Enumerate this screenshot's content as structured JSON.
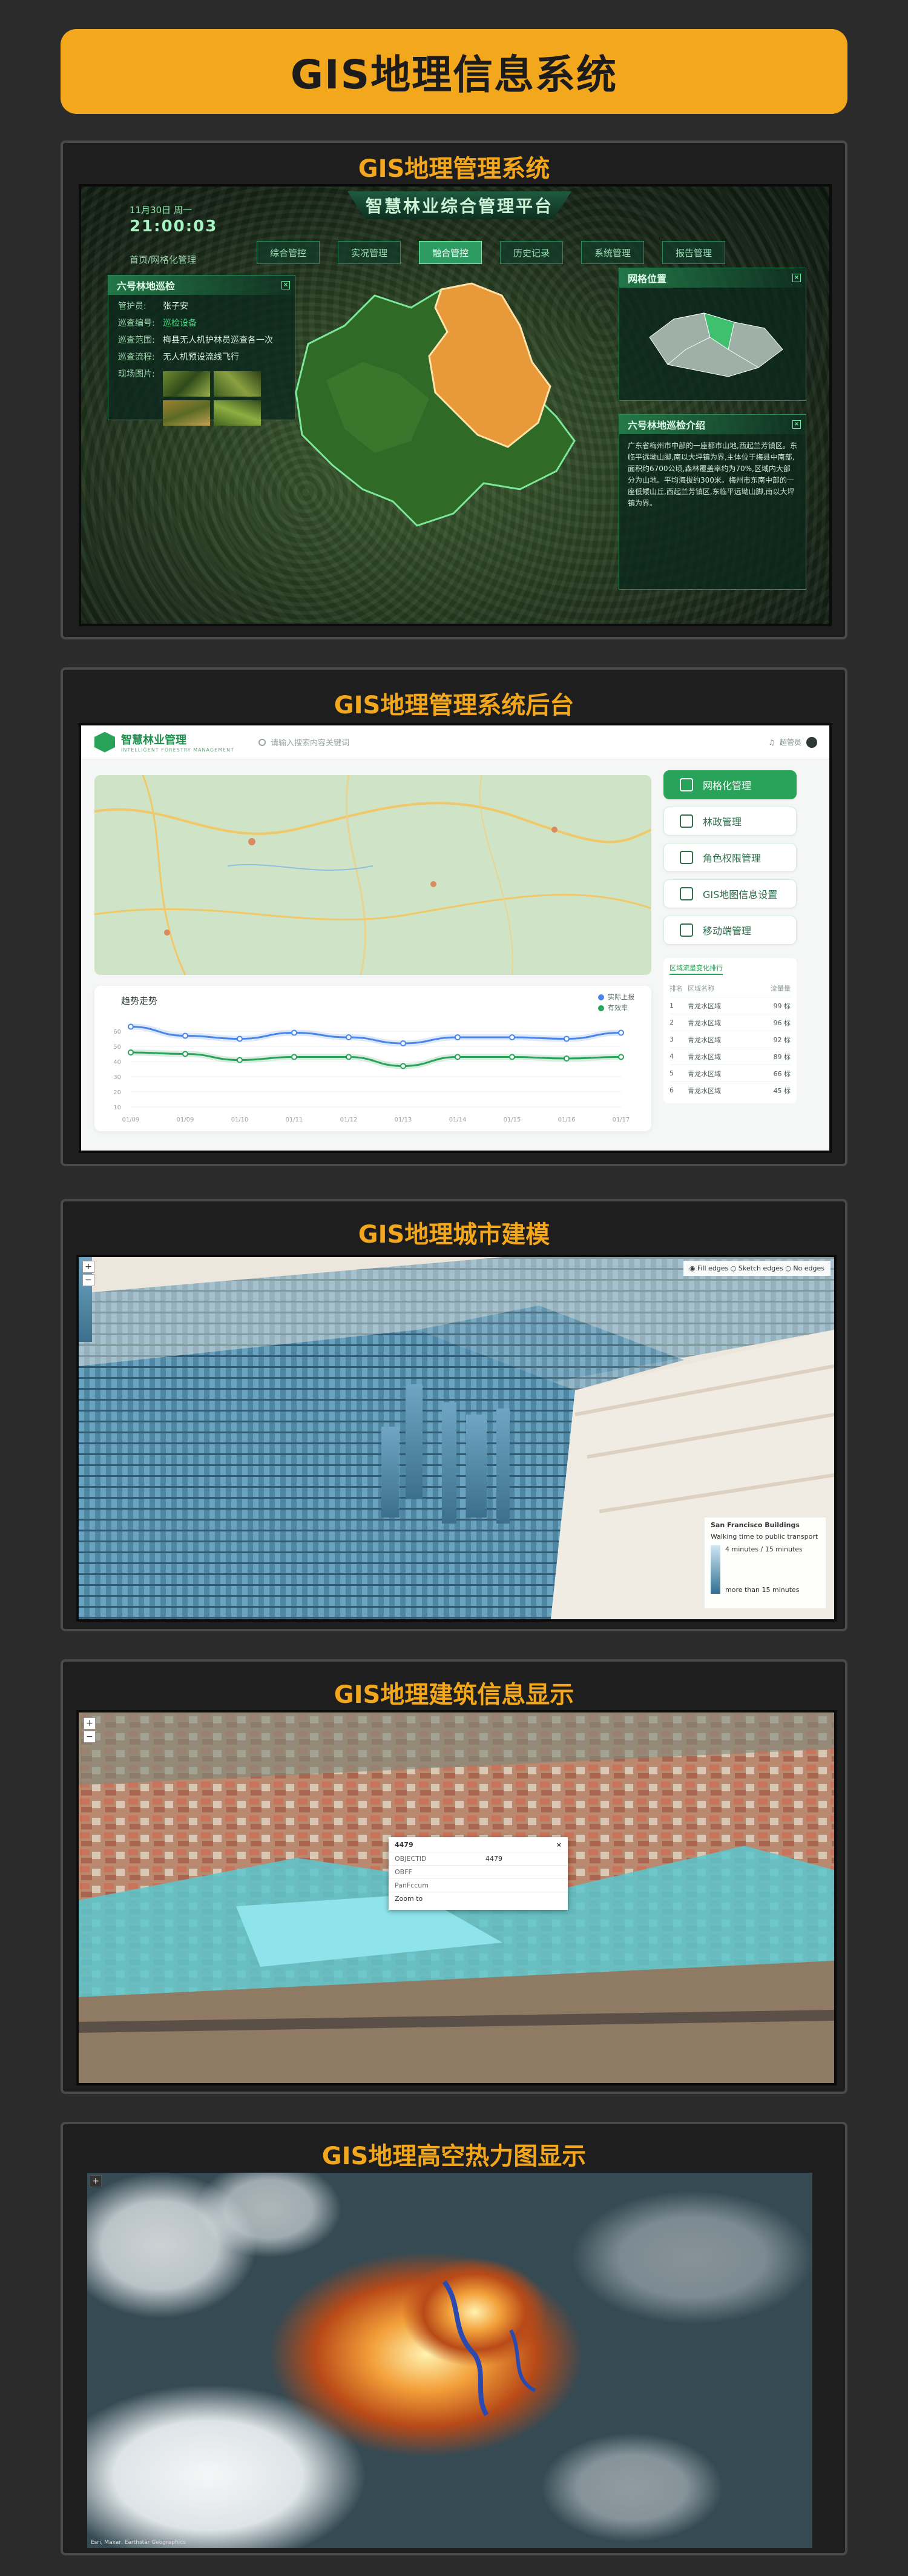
{
  "header": {
    "title": "GIS地理信息系统"
  },
  "colors": {
    "accent": "#f3a71c",
    "background": "#2b2b2b",
    "green": "#2aa35a"
  },
  "sections": [
    {
      "title": "GIS地理管理系统"
    },
    {
      "title": "GIS地理管理系统后台"
    },
    {
      "title": "GIS地理城市建模"
    },
    {
      "title": "GIS地理建筑信息显示"
    },
    {
      "title": "GIS地理高空热力图显示"
    }
  ],
  "dashboard": {
    "title": "智慧林业综合管理平台",
    "date": "11月30日 周一",
    "time": "21:00:03",
    "breadcrumb": "首页/网格化管理",
    "nav": [
      "综合管控",
      "实况管理",
      "融合管控",
      "历史记录",
      "系统管理",
      "报告管理"
    ],
    "nav_active_index": 2,
    "left_panel": {
      "title": "六号林地巡检",
      "rows": [
        {
          "k": "管护员:",
          "v": "张子安"
        },
        {
          "k": "巡查编号:",
          "v": "巡检设备"
        },
        {
          "k": "巡查范围:",
          "v": "梅县无人机护林员巡查各一次"
        },
        {
          "k": "巡查流程:",
          "v": "无人机预设流线飞行"
        },
        {
          "k": "现场图片:",
          "v": ""
        }
      ]
    },
    "right_top_panel": {
      "title": "网格位置"
    },
    "right_bottom_panel": {
      "title": "六号林地巡检介绍",
      "text": "广东省梅州市中部的一座都市山地,西起兰芳镇区。东临平远坳山脚,南以大坪镇为界,主体位于梅县中南部,面积约6700公顷,森林覆盖率约为70%,区域内大部分为山地。平均海拔约300米。梅州市东南中部的一座低矮山丘,西起兰芳镇区,东临平远坳山脚,南以大坪镇为界。"
    }
  },
  "admin": {
    "brand": "智慧林业管理",
    "brand_sub": "INTELLIGENT FORESTRY MANAGEMENT",
    "search_placeholder": "请输入搜索内容关键词",
    "user": "超管员",
    "chart_title": "趋势走势",
    "legend": [
      "实际上报",
      "有效率"
    ],
    "menu": [
      "网格化管理",
      "林政管理",
      "角色权限管理",
      "GIS地图信息设置",
      "移动端管理"
    ],
    "menu_active_index": 0,
    "table_tab": "区域流量变化排行",
    "table_headers": [
      "排名",
      "区域名称",
      "流量量"
    ],
    "table_rows": [
      {
        "rank": "1",
        "name": "青龙水区域",
        "value": "99 标"
      },
      {
        "rank": "2",
        "name": "青龙水区域",
        "value": "96 标"
      },
      {
        "rank": "3",
        "name": "青龙水区域",
        "value": "92 标"
      },
      {
        "rank": "4",
        "name": "青龙水区域",
        "value": "89 标"
      },
      {
        "rank": "5",
        "name": "青龙水区域",
        "value": "66 标"
      },
      {
        "rank": "6",
        "name": "青龙水区域",
        "value": "45 标"
      }
    ]
  },
  "chart_data": {
    "type": "line",
    "title": "趋势走势",
    "x": [
      "01/09",
      "01/09",
      "01/10",
      "01/11",
      "01/12",
      "01/13",
      "01/14",
      "01/15",
      "01/16",
      "01/17"
    ],
    "series": [
      {
        "name": "实际上报",
        "values": [
          63,
          57,
          55,
          59,
          56,
          52,
          56,
          56,
          55,
          59
        ]
      },
      {
        "name": "有效率",
        "values": [
          46,
          45,
          41,
          43,
          43,
          37,
          43,
          43,
          42,
          43
        ]
      }
    ],
    "ylim": [
      10,
      70
    ],
    "yticks": [
      "60",
      "50",
      "40",
      "30",
      "20",
      "10"
    ],
    "grid": true,
    "legend": "top-right"
  },
  "city_model": {
    "options": [
      "Fill edges",
      "Sketch edges",
      "No edges"
    ],
    "legend_title": "San Francisco Buildings",
    "legend_sub": "Walking time to public transport",
    "legend_min": "4 minutes / 15 minutes",
    "legend_max": "more than 15 minutes"
  },
  "building_info": {
    "popup_title": "4479",
    "popup_rows": [
      {
        "k": "OBJECTID",
        "v": "4479"
      },
      {
        "k": "OBFF",
        "v": ""
      },
      {
        "k": "PanFccum",
        "v": ""
      }
    ],
    "popup_link": "Zoom to"
  },
  "heatmap": {
    "attribution": "Esri, Maxar, Earthstar Geographics"
  }
}
